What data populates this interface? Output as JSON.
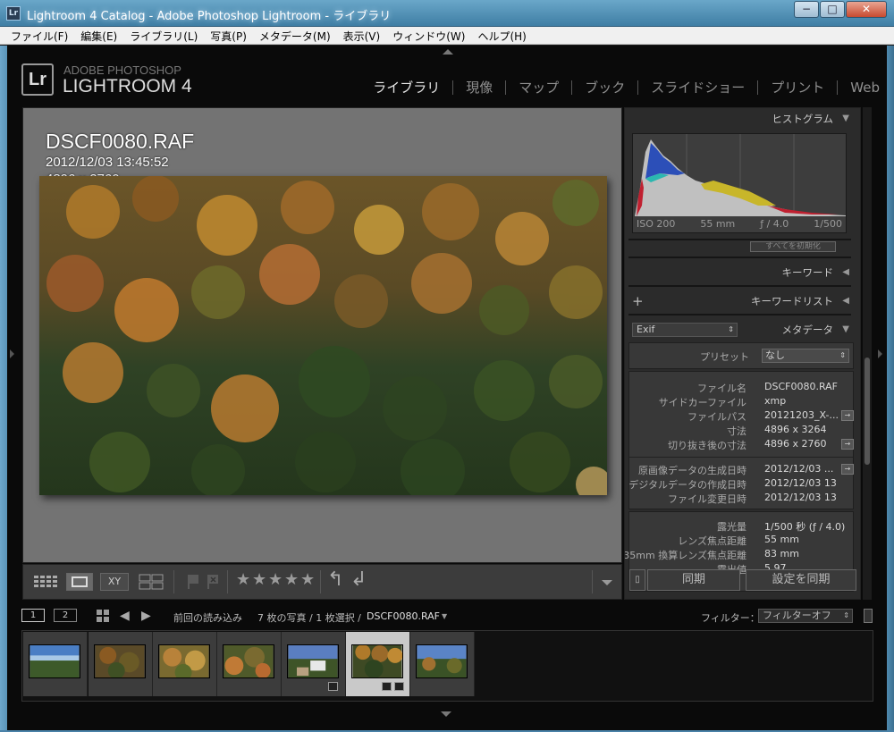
{
  "window": {
    "title": "Lightroom 4 Catalog - Adobe Photoshop Lightroom - ライブラリ",
    "app_icon": "Lr",
    "minimize": "−",
    "maximize": "□",
    "close": "✕"
  },
  "menu": [
    "ファイル(F)",
    "編集(E)",
    "ライブラリ(L)",
    "写真(P)",
    "メタデータ(M)",
    "表示(V)",
    "ウィンドウ(W)",
    "ヘルプ(H)"
  ],
  "brand": {
    "logo": "Lr",
    "top": "ADOBE PHOTOSHOP",
    "main": "LIGHTROOM 4"
  },
  "modules": [
    {
      "label": "ライブラリ",
      "active": true
    },
    {
      "label": "現像",
      "active": false
    },
    {
      "label": "マップ",
      "active": false
    },
    {
      "label": "ブック",
      "active": false
    },
    {
      "label": "スライドショー",
      "active": false
    },
    {
      "label": "プリント",
      "active": false
    },
    {
      "label": "Web",
      "active": false
    }
  ],
  "loupe": {
    "file_name": "DSCF0080.RAF",
    "datetime": "2012/12/03 13:45:52",
    "dimensions": "4896 x 2760"
  },
  "toolbar": {
    "grid_icon": "grid-view",
    "loupe_icon": "loupe-view",
    "compare_label": "XY",
    "survey_icon": "survey-view",
    "stars": [
      "★",
      "★",
      "★",
      "★",
      "★"
    ],
    "rotate_left": "↰",
    "rotate_right": "↲"
  },
  "histogram": {
    "title": "ヒストグラム",
    "iso": "ISO 200",
    "focal": "55 mm",
    "aperture": "ƒ / 4.0",
    "shutter": "1/500"
  },
  "quick_develop_label": "すべてを初期化",
  "panels": {
    "keyword": "キーワード",
    "keyword_list": "キーワードリスト",
    "metadata": "メタデータ",
    "metadata_preset_select": "Exif",
    "preset_label": "プリセット",
    "preset_value": "なし"
  },
  "metadata_rows": [
    {
      "label": "ファイル名",
      "value": "DSCF0080.RAF",
      "go": false
    },
    {
      "label": "サイドカーファイル",
      "value": "xmp",
      "go": false
    },
    {
      "label": "ファイルパス",
      "value": "20121203_X-...",
      "go": true
    },
    {
      "label": "寸法",
      "value": "4896 x 3264",
      "go": false
    },
    {
      "label": "切り抜き後の寸法",
      "value": "4896 x 2760",
      "go": true
    }
  ],
  "metadata_dates": [
    {
      "label": "原画像データの生成日時",
      "value": "2012/12/03 ...",
      "go": true
    },
    {
      "label": "デジタルデータの作成日時",
      "value": "2012/12/03 13:4...",
      "go": false
    },
    {
      "label": "ファイル変更日時",
      "value": "2012/12/03 13:4...",
      "go": false
    }
  ],
  "metadata_exif": [
    {
      "label": "露光量",
      "value": "1/500 秒 (ƒ / 4.0)"
    },
    {
      "label": "レンズ焦点距離",
      "value": "55 mm"
    },
    {
      "label": "35mm 換算レンズ焦点距離",
      "value": "83 mm"
    },
    {
      "label": "露出値",
      "value": "5.97"
    }
  ],
  "sync": {
    "sync_label": "同期",
    "sync_settings_label": "設定を同期"
  },
  "filmstrip_bar": {
    "screen1": "1",
    "screen2": "2",
    "source": "前回の読み込み",
    "count": "7 枚の写真 / 1 枚選択 /",
    "selected": "DSCF0080.RAF",
    "filter_label": "フィルター：",
    "filter_value": "フィルターオフ"
  },
  "thumbnails": [
    {
      "scene": "sky-valley",
      "selected": false,
      "badges": 0
    },
    {
      "scene": "autumn-dark",
      "selected": false,
      "badges": 0
    },
    {
      "scene": "autumn-bright",
      "selected": false,
      "badges": 0
    },
    {
      "scene": "autumn-close",
      "selected": false,
      "badges": 0
    },
    {
      "scene": "village",
      "selected": false,
      "badges": 1
    },
    {
      "scene": "forest-selected",
      "selected": true,
      "badges": 2
    },
    {
      "scene": "sky-forest",
      "selected": false,
      "badges": 0
    }
  ],
  "colors": {
    "panel_bg": "#2b2b2b",
    "loupe_bg": "#737373",
    "app_bg": "#0a0a0a",
    "text_active": "#e6e6e6"
  }
}
